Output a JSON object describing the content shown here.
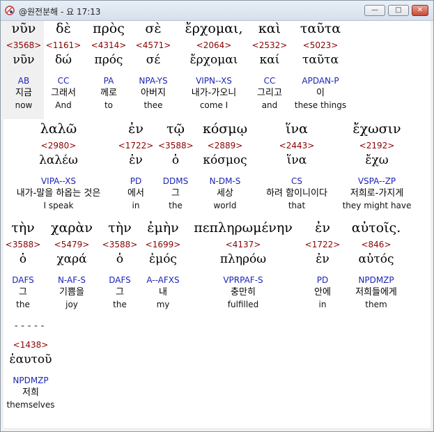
{
  "window": {
    "title": "@원전분해 - 요 17:13",
    "minimize_label": "—",
    "maximize_label": "□",
    "close_label": "✕"
  },
  "separator": "-----",
  "rows": [
    {
      "words": [
        {
          "greek": "νῦν",
          "strong": "<3568>",
          "lexeme": "νῦν",
          "parsing": "AB",
          "korean": "지금",
          "english": "now"
        },
        {
          "greek": "δὲ",
          "strong": "<1161>",
          "lexeme": "δώ",
          "parsing": "CC",
          "korean": "그래서",
          "english": "And"
        },
        {
          "greek": "πρὸς",
          "strong": "<4314>",
          "lexeme": "πρός",
          "parsing": "PA",
          "korean": "께로",
          "english": "to"
        },
        {
          "greek": "σὲ",
          "strong": "<4571>",
          "lexeme": "σέ",
          "parsing": "NPA-YS",
          "korean": "아버지",
          "english": "thee"
        },
        {
          "greek": "ἔρχομαι,",
          "strong": "<2064>",
          "lexeme": "ἔρχομαι",
          "parsing": "VIPN--XS",
          "korean": "내가-가오니",
          "english": "come I"
        },
        {
          "greek": "καὶ",
          "strong": "<2532>",
          "lexeme": "καί",
          "parsing": "CC",
          "korean": "그리고",
          "english": "and"
        },
        {
          "greek": "ταῦτα",
          "strong": "<5023>",
          "lexeme": "ταῦτα",
          "parsing": "APDAN-P",
          "korean": "이",
          "english": "these things"
        }
      ]
    },
    {
      "words": [
        {
          "greek": "λαλῶ",
          "strong": "<2980>",
          "lexeme": "λαλέω",
          "parsing": "VIPA--XS",
          "korean": "내가-말을 하옵는 것은",
          "english": "I speak"
        },
        {
          "greek": "ἐν",
          "strong": "<1722>",
          "lexeme": "ἐν",
          "parsing": "PD",
          "korean": "에서",
          "english": "in"
        },
        {
          "greek": "τῷ",
          "strong": "<3588>",
          "lexeme": "ὁ",
          "parsing": "DDMS",
          "korean": "그",
          "english": "the"
        },
        {
          "greek": "κόσμῳ",
          "strong": "<2889>",
          "lexeme": "κόσμος",
          "parsing": "N-DM-S",
          "korean": "세상",
          "english": "world"
        },
        {
          "greek": "ἵνα",
          "strong": "<2443>",
          "lexeme": "ἵνα",
          "parsing": "CS",
          "korean": "하려 함이니이다",
          "english": "that"
        },
        {
          "greek": "ἔχωσιν",
          "strong": "<2192>",
          "lexeme": "ἔχω",
          "parsing": "VSPA--ZP",
          "korean": "저희로-가지게",
          "english": "they might have"
        }
      ]
    },
    {
      "words": [
        {
          "greek": "τὴν",
          "strong": "<3588>",
          "lexeme": "ὁ",
          "parsing": "DAFS",
          "korean": "그",
          "english": "the"
        },
        {
          "greek": "χαρὰν",
          "strong": "<5479>",
          "lexeme": "χαρά",
          "parsing": "N-AF-S",
          "korean": "기쁨을",
          "english": "joy"
        },
        {
          "greek": "τὴν",
          "strong": "<3588>",
          "lexeme": "ὁ",
          "parsing": "DAFS",
          "korean": "그",
          "english": "the"
        },
        {
          "greek": "ἐμὴν",
          "strong": "<1699>",
          "lexeme": "ἐμός",
          "parsing": "A--AFXS",
          "korean": "내",
          "english": "my"
        },
        {
          "greek": "πεπληρωμένην",
          "strong": "<4137>",
          "lexeme": "πληρόω",
          "parsing": "VPRPAF-S",
          "korean": "충만히",
          "english": "fulfilled"
        },
        {
          "greek": "ἐν",
          "strong": "<1722>",
          "lexeme": "ἐν",
          "parsing": "PD",
          "korean": "안에",
          "english": "in"
        },
        {
          "greek": "αὐτοῖς.",
          "strong": "<846>",
          "lexeme": "αὐτός",
          "parsing": "NPDMZP",
          "korean": "저희들에게",
          "english": "them"
        }
      ]
    },
    {
      "words": [
        {
          "greek": "ἑαυτοῦ",
          "strong": "<1438>",
          "lexeme": "ἑαυτοῦ",
          "parsing": "NPDMZP",
          "korean": "저희",
          "english": "themselves"
        }
      ]
    }
  ],
  "colors": {
    "strong_number": "#8b0000",
    "parsing": "#1b24b8",
    "highlight": "#f0f0f0"
  }
}
